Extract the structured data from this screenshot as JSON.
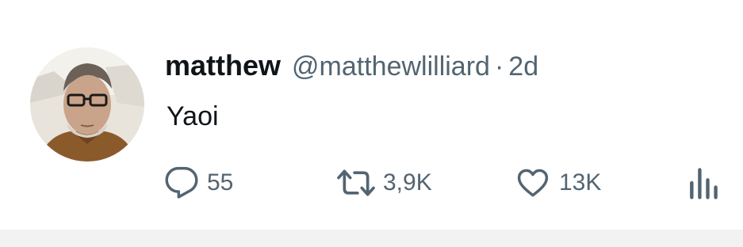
{
  "user": {
    "display_name": "matthew",
    "handle": "@matthewlilliard",
    "separator": "·",
    "time": "2d"
  },
  "tweet": {
    "text": "Yaoi"
  },
  "actions": {
    "reply": {
      "icon": "reply-icon",
      "count": "55"
    },
    "repost": {
      "icon": "repost-icon",
      "count": "3,9K"
    },
    "like": {
      "icon": "heart-icon",
      "count": "13K"
    },
    "views": {
      "icon": "views-icon"
    }
  },
  "colors": {
    "text_primary": "#0f1419",
    "text_secondary": "#536471",
    "background": "#ffffff"
  }
}
